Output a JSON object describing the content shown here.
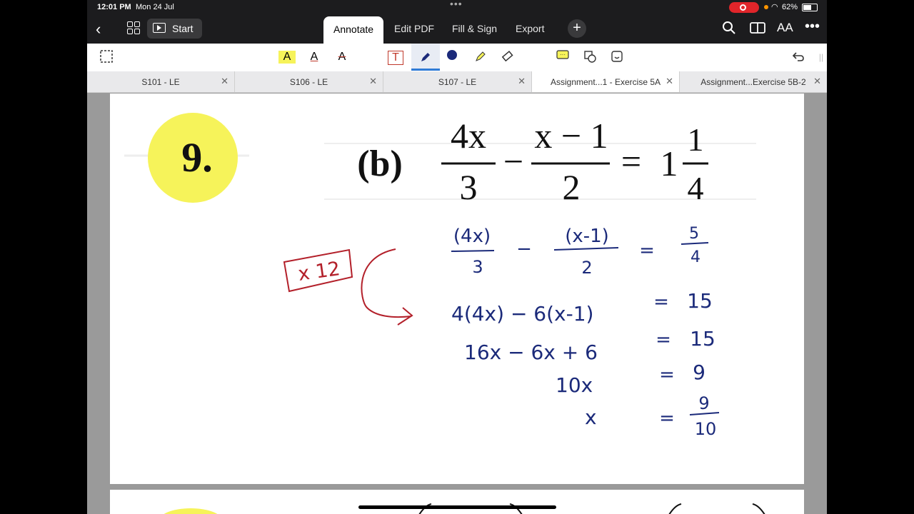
{
  "status_bar": {
    "time": "12:01 PM",
    "date": "Mon 24 Jul",
    "battery": "62%"
  },
  "nav": {
    "start_label": "Start",
    "tabs": [
      "Annotate",
      "Edit PDF",
      "Fill & Sign",
      "Export"
    ],
    "active_tab": "Annotate"
  },
  "doc_tabs": [
    {
      "label": "S101 - LE",
      "active": false
    },
    {
      "label": "S106 - LE",
      "active": false
    },
    {
      "label": "S107 - LE",
      "active": false
    },
    {
      "label": "Assignment...1 - Exercise 5A",
      "active": true
    },
    {
      "label": "Assignment...Exercise 5B-2",
      "active": false
    }
  ],
  "problem": {
    "number": "9.",
    "part": "(b)",
    "frac1_num": "4x",
    "frac1_den": "3",
    "frac2_num": "x − 1",
    "frac2_den": "2",
    "minus": "−",
    "equals": "=",
    "mixed_whole": "1",
    "mixed_num": "1",
    "mixed_den": "4"
  },
  "handwriting": {
    "box_label": "x 12",
    "line1": {
      "a_num": "(4x)",
      "a_den": "3",
      "op": "−",
      "b_num": "(x-1)",
      "b_den": "2",
      "eq": "=",
      "r_num": "5",
      "r_den": "4"
    },
    "line2": {
      "lhs": "4(4x) − 6(x-1)",
      "eq": "=",
      "rhs": "15"
    },
    "line3": {
      "lhs": "16x − 6x + 6",
      "eq": "=",
      "rhs": "15"
    },
    "line4": {
      "lhs": "10x",
      "eq": "=",
      "rhs": "9"
    },
    "line5": {
      "lhs": "x",
      "eq": "=",
      "r_num": "9",
      "r_den": "10"
    }
  },
  "colors": {
    "ink": "#1b2a7a",
    "red_ink": "#b3202a",
    "highlight": "#f6f35a"
  }
}
